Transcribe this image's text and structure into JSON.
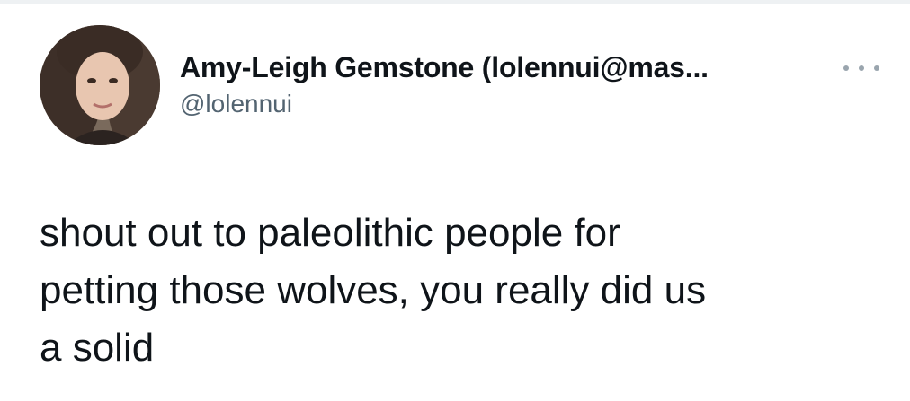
{
  "tweet": {
    "author": {
      "display_name": "Amy-Leigh Gemstone (lolennui@mas...",
      "handle": "@lolennui",
      "avatar_icon": "profile-photo"
    },
    "more_icon": "more-options-icon",
    "text": "shout out to paleolithic people for\npetting those wolves, you really did us\na solid"
  }
}
